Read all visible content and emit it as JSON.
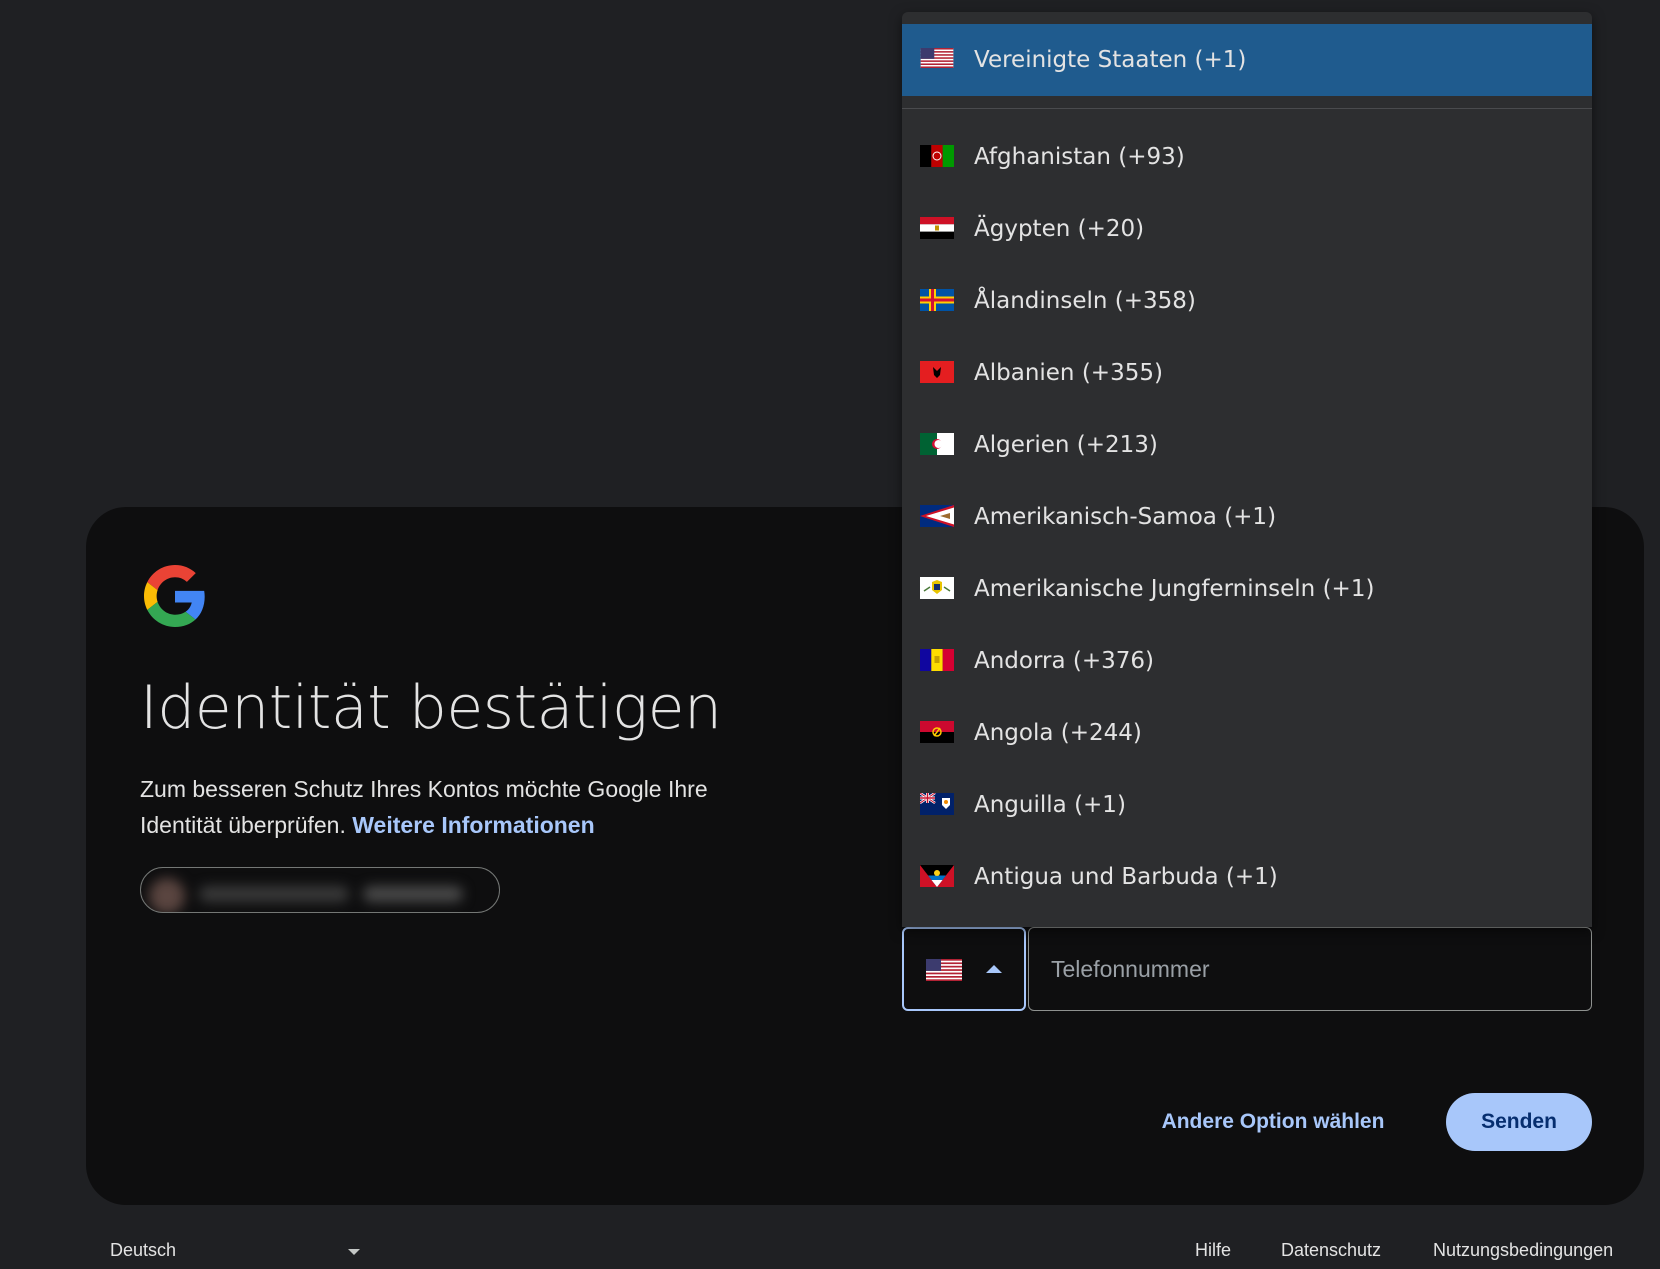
{
  "card": {
    "title": "Identität bestätigen",
    "description": "Zum besseren Schutz Ihres Kontos möchte Google Ihre Identität überprüfen.",
    "learn_more": "Weitere Informationen"
  },
  "phone": {
    "selected_country": "us-flag-icon",
    "placeholder": "Telefonnummer"
  },
  "actions": {
    "alt_option": "Andere Option wählen",
    "send": "Senden"
  },
  "footer": {
    "language": "Deutsch",
    "help": "Hilfe",
    "privacy": "Datenschutz",
    "terms": "Nutzungsbedingungen"
  },
  "dropdown": {
    "selected": {
      "label": "Vereinigte Staaten (+1)",
      "flag": "us-flag-icon"
    },
    "items": [
      {
        "label": "Afghanistan (+93)",
        "flag": "af-flag-icon"
      },
      {
        "label": "Ägypten (+20)",
        "flag": "eg-flag-icon"
      },
      {
        "label": "Ålandinseln (+358)",
        "flag": "ax-flag-icon"
      },
      {
        "label": "Albanien (+355)",
        "flag": "al-flag-icon"
      },
      {
        "label": "Algerien (+213)",
        "flag": "dz-flag-icon"
      },
      {
        "label": "Amerikanisch-Samoa (+1)",
        "flag": "as-flag-icon"
      },
      {
        "label": "Amerikanische Jungferninseln (+1)",
        "flag": "vi-flag-icon"
      },
      {
        "label": "Andorra (+376)",
        "flag": "ad-flag-icon"
      },
      {
        "label": "Angola (+244)",
        "flag": "ao-flag-icon"
      },
      {
        "label": "Anguilla (+1)",
        "flag": "ai-flag-icon"
      },
      {
        "label": "Antigua und Barbuda (+1)",
        "flag": "ag-flag-icon"
      }
    ]
  },
  "colors": {
    "page_bg": "#1f2023",
    "card_bg": "#0e0e0f",
    "accent": "#a8c7fa",
    "dropdown_bg": "#2d2e30",
    "selected_bg": "#1f5b8e"
  }
}
